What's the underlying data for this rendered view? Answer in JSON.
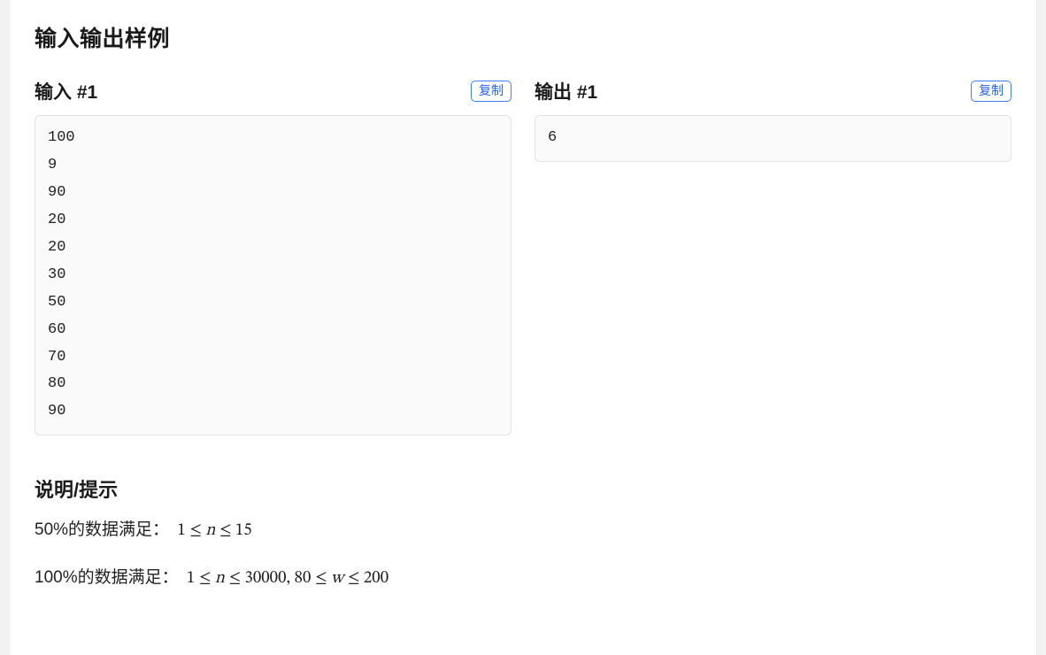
{
  "section_title": "输入输出样例",
  "io": {
    "input_label": "输入 #1",
    "output_label": "输出 #1",
    "copy_label": "复制",
    "input_content": "100\n9\n90\n20\n20\n30\n50\n60\n70\n80\n90",
    "output_content": "6"
  },
  "hints": {
    "title": "说明/提示",
    "lines": [
      {
        "prefix": "50%的数据满足：",
        "math": "1 ≤ n ≤ 15"
      },
      {
        "prefix": "100%的数据满足：",
        "math": "1 ≤ n ≤ 30000, 80 ≤ w ≤ 200"
      }
    ]
  }
}
